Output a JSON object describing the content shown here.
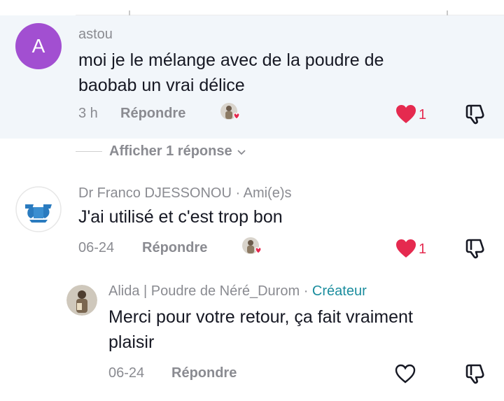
{
  "comments": [
    {
      "author": "astou",
      "avatar_letter": "A",
      "text_line1": "moi je le mélange avec de la poudre de",
      "text_line2": "baobab un vrai délice",
      "time": "3 h",
      "reply_label": "Répondre",
      "likes": "1",
      "liked": true
    },
    {
      "author": "Dr Franco DJESSONOU",
      "tag": "· Ami(e)s",
      "text": "J'ai utilisé et c'est trop bon",
      "time": "06-24",
      "reply_label": "Répondre",
      "likes": "1",
      "liked": true
    },
    {
      "author": "Alida | Poudre de Néré_Durom",
      "tag_sep": "·",
      "tag": "Créateur",
      "text_line1": "Merci pour votre retour, ça fait vraiment",
      "text_line2": "plaisir",
      "time": "06-24",
      "reply_label": "Répondre",
      "liked": false
    }
  ],
  "show_replies": "Afficher 1 réponse",
  "colors": {
    "highlight_bg": "#f2f6fa",
    "like_red": "#e52a4f",
    "creator_teal": "#1b8d9e",
    "avatar_purple": "#a24fd1"
  },
  "icons": [
    "heart-filled-icon",
    "heart-outline-icon",
    "dislike-icon",
    "creator-liked-avatar-icon",
    "chevron-down-icon"
  ]
}
